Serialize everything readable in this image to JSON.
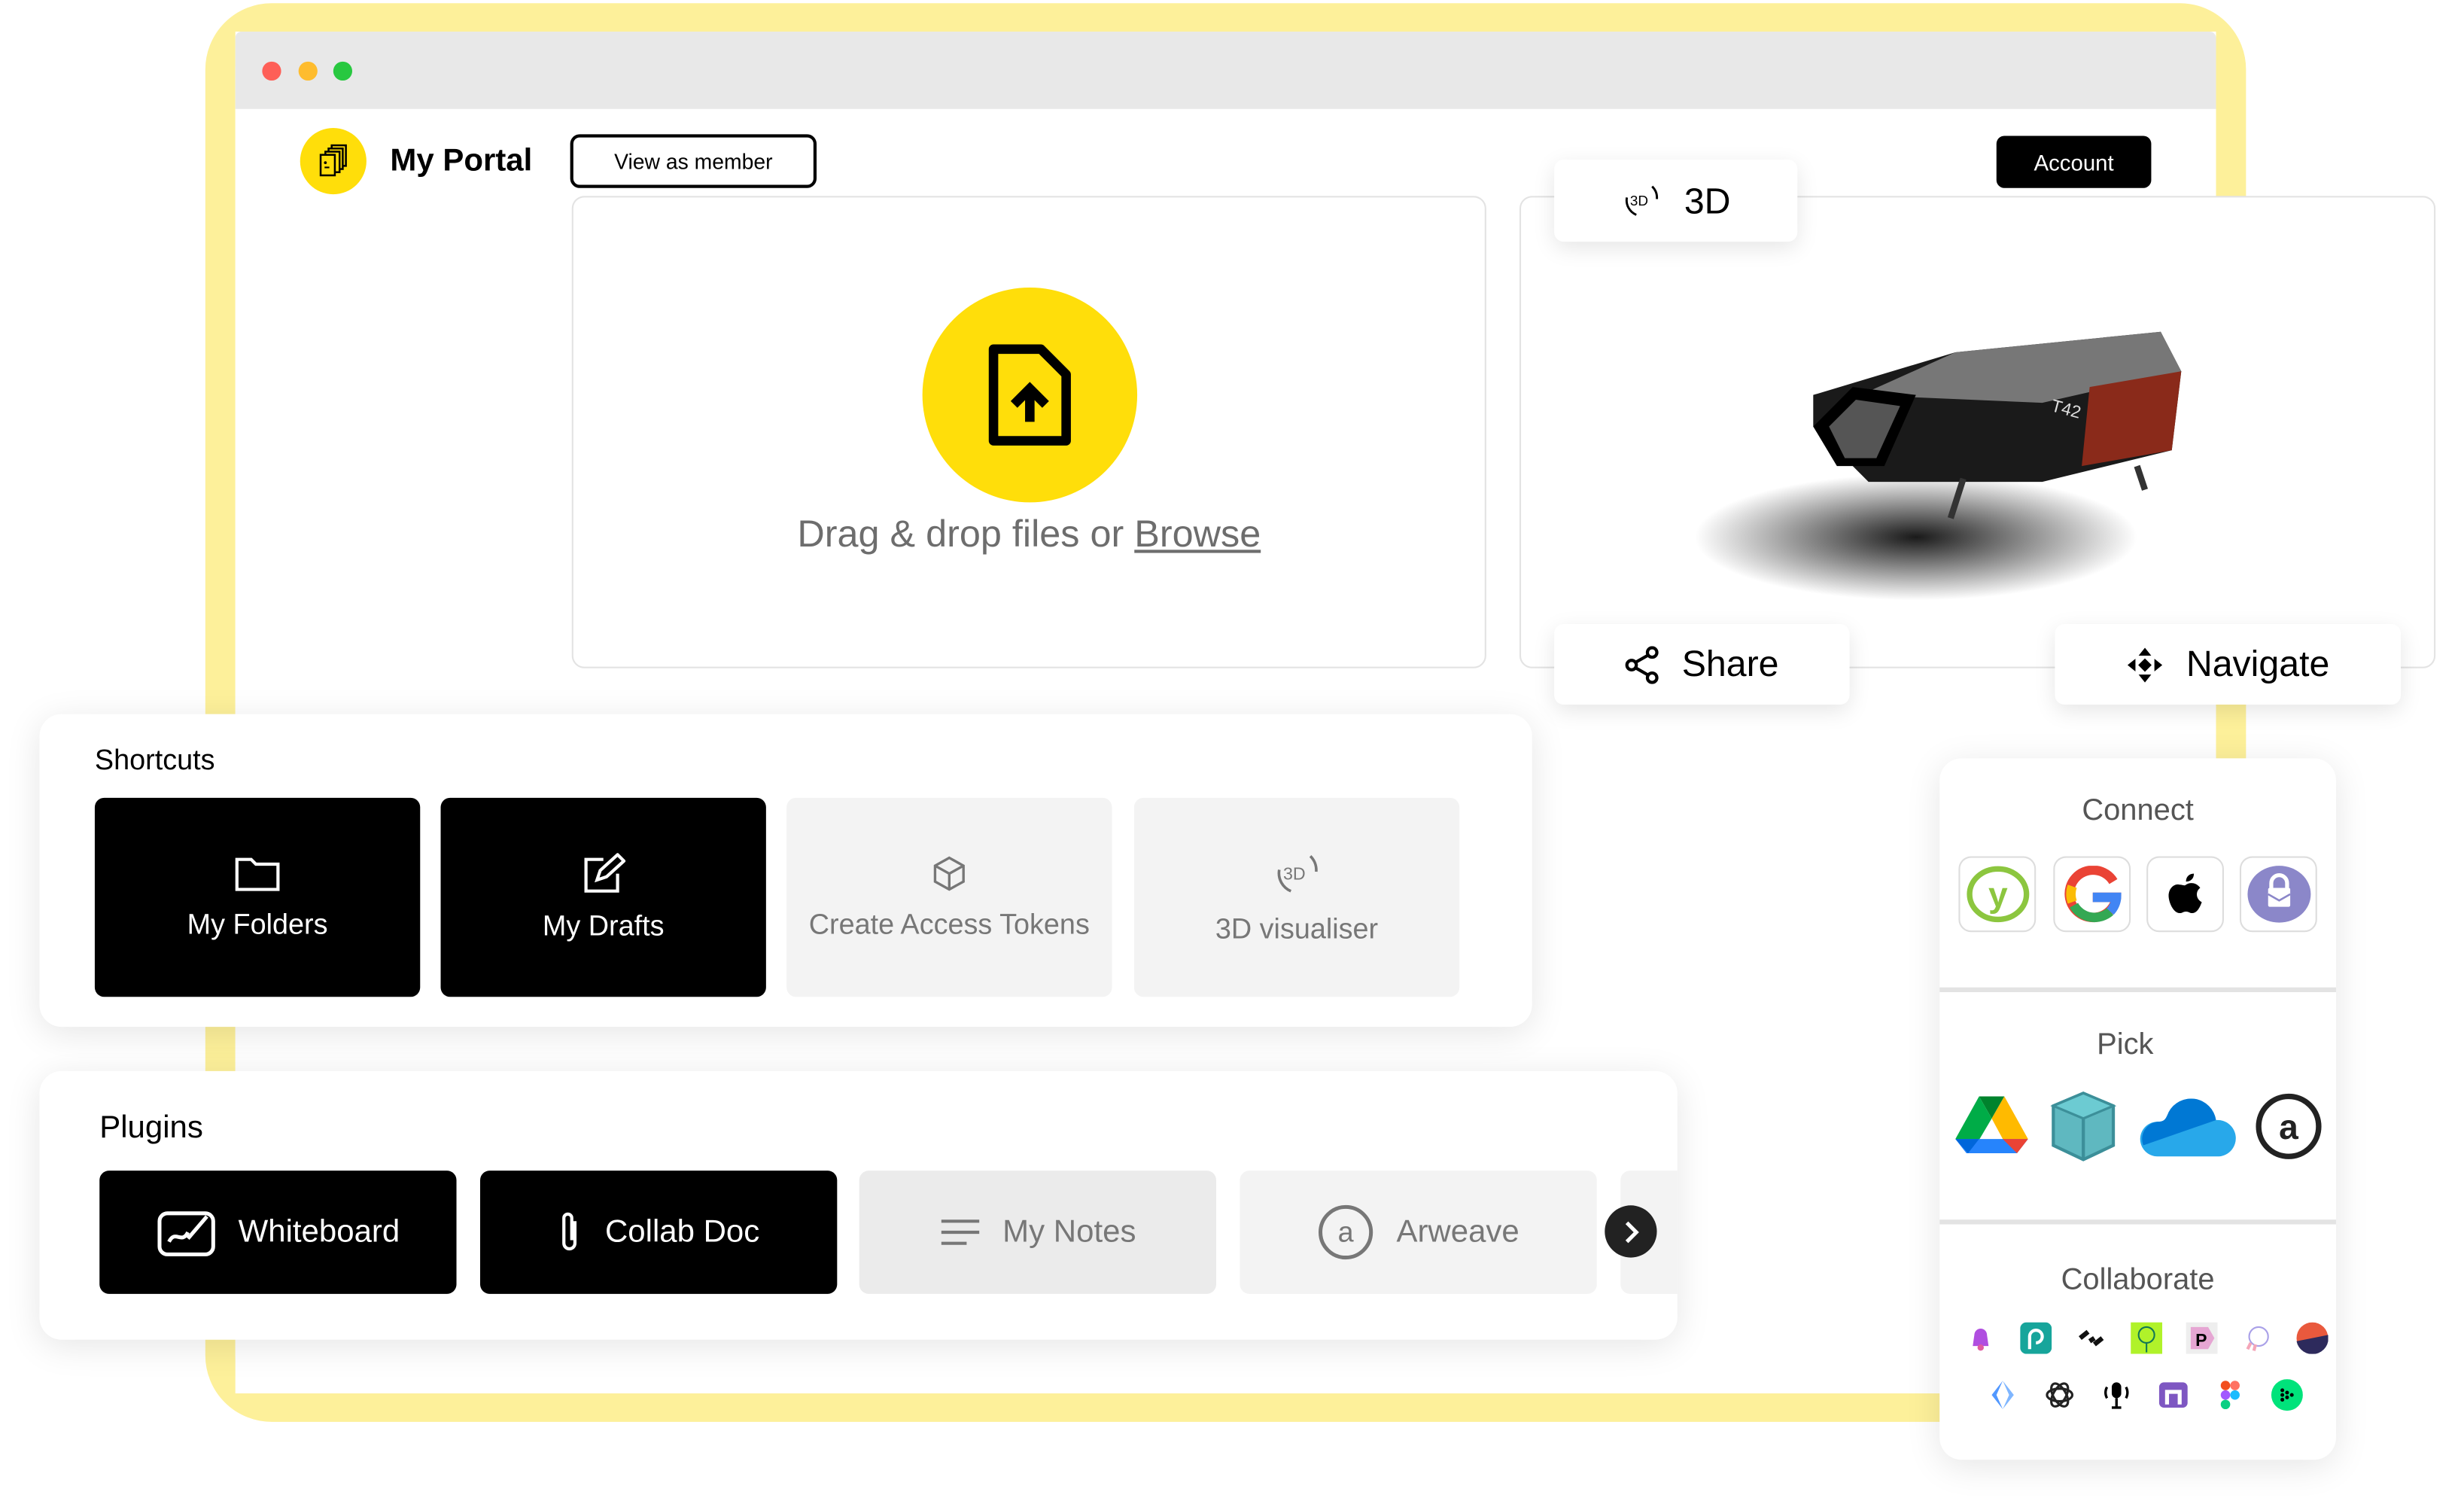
{
  "header": {
    "brand": "My Portal",
    "view_as_member": "View as member",
    "account": "Account"
  },
  "upload": {
    "prompt": "Drag & drop files or ",
    "browse": "Browse"
  },
  "viewer": {
    "tab_label": "3D",
    "tab_icon": "3d-rotate-icon",
    "model_label": "T42",
    "share": "Share",
    "navigate": "Navigate"
  },
  "shortcuts": {
    "title": "Shortcuts",
    "items": [
      {
        "label": "My Folders",
        "icon": "folder-icon",
        "active": true
      },
      {
        "label": "My Drafts",
        "icon": "edit-icon",
        "active": true
      },
      {
        "label": "Create Access Tokens",
        "icon": "cube-icon",
        "active": false
      },
      {
        "label": "3D visualiser",
        "icon": "3d-rotate-icon",
        "active": false
      }
    ]
  },
  "plugins": {
    "title": "Plugins",
    "items": [
      {
        "label": "Whiteboard",
        "icon": "whiteboard-icon",
        "active": true
      },
      {
        "label": "Collab Doc",
        "icon": "paperclip-icon",
        "active": true
      },
      {
        "label": "My Notes",
        "icon": "lines-icon",
        "active": false
      },
      {
        "label": "Arweave",
        "icon": "arweave-icon",
        "active": false
      }
    ]
  },
  "side": {
    "connect": "Connect",
    "pick": "Pick",
    "collaborate": "Collaborate",
    "connect_icons": [
      "yubikey-icon",
      "google-icon",
      "apple-icon",
      "protonmail-icon"
    ],
    "pick_icons": [
      "google-drive-icon",
      "box-icon",
      "onedrive-icon",
      "arweave-icon"
    ],
    "collab_icons": [
      "bell-icon",
      "spiral-icon",
      "link-icon",
      "tree-icon",
      "p-icon",
      "poap-icon",
      "half-circle-icon",
      "ens-icon",
      "openai-icon",
      "podcast-icon",
      "gate-icon",
      "figma-icon",
      "dots-icon"
    ]
  },
  "colors": {
    "accent": "#ffde0a",
    "frame": "#fdf09a",
    "dark": "#000000"
  }
}
